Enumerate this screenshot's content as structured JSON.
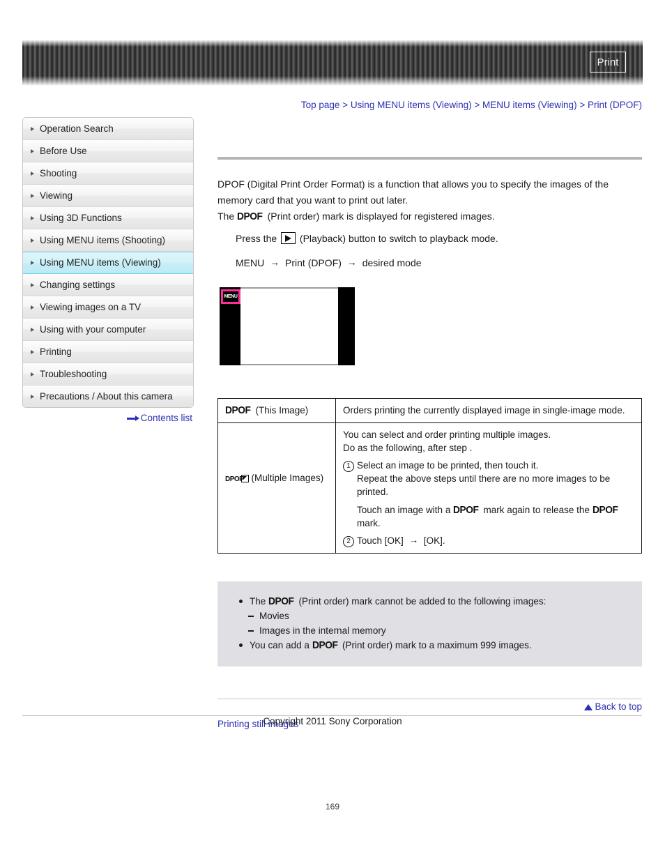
{
  "header": {
    "print_button_label": "Print"
  },
  "breadcrumb": {
    "items": [
      "Top page",
      "Using MENU items (Viewing)",
      "MENU items (Viewing)",
      "Print (DPOF)"
    ],
    "separator": ">",
    "full_text": "Top page > Using MENU items (Viewing) > MENU items (Viewing) > Print (DPOF)"
  },
  "sidebar": {
    "items": [
      {
        "label": "Operation Search",
        "active": false
      },
      {
        "label": "Before Use",
        "active": false
      },
      {
        "label": "Shooting",
        "active": false
      },
      {
        "label": "Viewing",
        "active": false
      },
      {
        "label": "Using 3D Functions",
        "active": false
      },
      {
        "label": "Using MENU items (Shooting)",
        "active": false
      },
      {
        "label": "Using MENU items (Viewing)",
        "active": true
      },
      {
        "label": "Changing settings",
        "active": false
      },
      {
        "label": "Viewing images on a TV",
        "active": false
      },
      {
        "label": "Using with your computer",
        "active": false
      },
      {
        "label": "Printing",
        "active": false
      },
      {
        "label": "Troubleshooting",
        "active": false
      },
      {
        "label": "Precautions / About this camera",
        "active": false
      }
    ],
    "contents_list_label": "Contents list"
  },
  "main": {
    "intro_line1": "DPOF (Digital Print Order Format) is a function that allows you to specify the images of the",
    "intro_line2": "memory card that you want to print out later.",
    "intro_line3_prefix": "The",
    "dpof_logo": "DPOF",
    "intro_line3_suffix": "(Print order) mark is displayed for registered images.",
    "step_playback_prefix": "Press the",
    "step_playback_suffix": "(Playback) button to switch to playback mode.",
    "menu_path": {
      "start": "MENU",
      "middle": "Print (DPOF)",
      "end": "desired mode",
      "arrow": "→"
    },
    "figure": {
      "menu_button_label": "MENU"
    }
  },
  "table": {
    "rows": [
      {
        "mode_icon": "DPOF",
        "mode_label": "(This Image)",
        "description_lines": [
          "Orders printing the currently displayed image in single-image mode."
        ]
      },
      {
        "mode_icon": "DPOF",
        "mode_label": "(Multiple Images)",
        "intro_lines": [
          "You can select and order printing multiple images.",
          "Do as the following, after step    ."
        ],
        "steps": [
          {
            "number": "1",
            "lines": [
              "Select an image to be printed, then touch it.",
              "Repeat the above steps until there are no more images to be",
              "printed."
            ],
            "release_line": {
              "prefix": "Touch an image with a",
              "middle": "mark again to release the",
              "suffix": "mark."
            }
          },
          {
            "number": "2",
            "text_before": "Touch [OK]",
            "arrow": "→",
            "text_after": "[OK]."
          }
        ]
      }
    ]
  },
  "notes": [
    {
      "type": "bullet",
      "prefix": "The",
      "icon": "DPOF",
      "suffix": "(Print order) mark cannot be added to the following images:"
    },
    {
      "type": "dash",
      "text": "Movies"
    },
    {
      "type": "dash",
      "text": "Images in the internal memory"
    },
    {
      "type": "bullet",
      "prefix": "You can add a",
      "icon": "DPOF",
      "suffix": "(Print order) mark to a maximum 999 images."
    }
  ],
  "footer": {
    "related_link": "Printing still images",
    "back_to_top": "Back to top",
    "copyright": "Copyright 2011 Sony Corporation",
    "page_number": "169"
  },
  "colors": {
    "link": "#2b30b0",
    "active_nav": "#c7eef7",
    "note_bg": "#dfdfe4",
    "highlight_pink": "#ff2f9a"
  }
}
